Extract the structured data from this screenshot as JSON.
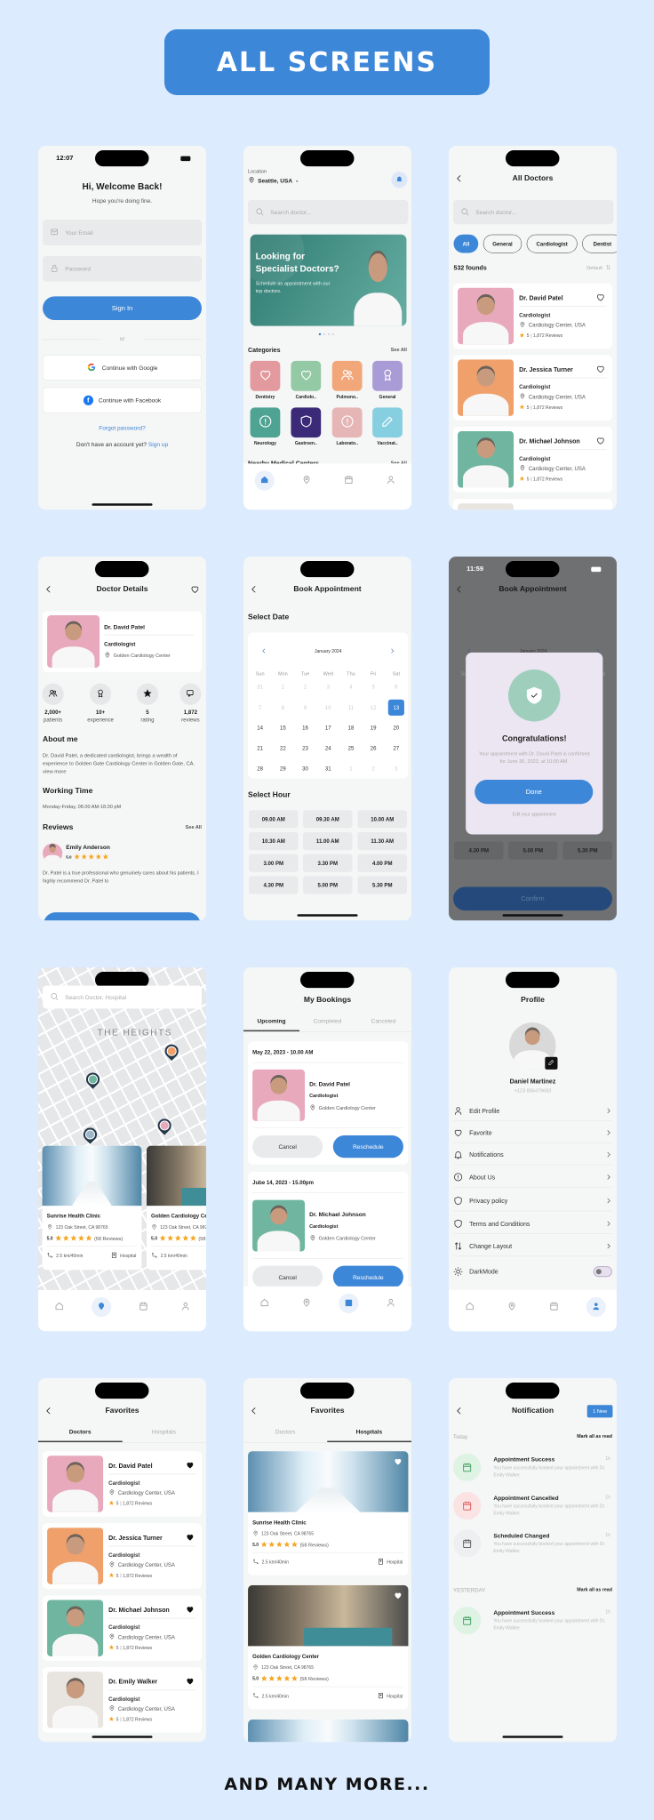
{
  "header": {
    "title": "ALL SCREENS"
  },
  "footer": {
    "text": "AND MANY MORE..."
  },
  "colors": {
    "primary": "#3d87d9",
    "background": "#dcebfd",
    "star": "#f5a623"
  },
  "login": {
    "time": "12:07",
    "title": "Hi, Welcome Back!",
    "subtitle": "Hope you're doing fine.",
    "email_placeholder": "Your Email",
    "password_placeholder": "Password",
    "sign_in": "Sign In",
    "or": "or",
    "google": "Continue with Google",
    "facebook": "Continue with Facebook",
    "forgot": "Forgot password?",
    "no_account": "Don't have an account yet?",
    "sign_up": "Sign up"
  },
  "home": {
    "location_label": "Location",
    "location": "Seattle, USA",
    "search_placeholder": "Search doctor...",
    "banner_title_1": "Looking for",
    "banner_title_2": "Specialist Doctors?",
    "banner_text": "Schedule an appointment with our top doctors.",
    "banner_page": 1,
    "banner_pages": 4,
    "categories_title": "Categories",
    "see_all": "See All",
    "categories": [
      {
        "label": "Dentistry",
        "color": "#e39a9e",
        "icon": "tooth-icon"
      },
      {
        "label": "Cardiolo..",
        "color": "#93c9a4",
        "icon": "heart-pulse-icon"
      },
      {
        "label": "Pulmono..",
        "color": "#f2a77a",
        "icon": "lungs-icon"
      },
      {
        "label": "General",
        "color": "#a99bd6",
        "icon": "stethoscope-icon"
      },
      {
        "label": "Neurology",
        "color": "#4ea393",
        "icon": "brain-icon"
      },
      {
        "label": "Gastroen..",
        "color": "#3b2a78",
        "icon": "stomach-icon"
      },
      {
        "label": "Laborato..",
        "color": "#e6b5b5",
        "icon": "flask-icon"
      },
      {
        "label": "Vaccinat..",
        "color": "#86cfe0",
        "icon": "syringe-icon"
      }
    ],
    "nearby_title": "Nearby Medical Centers",
    "nearby_see_all": "See All"
  },
  "all_doctors": {
    "title": "All Doctors",
    "search_placeholder": "Search doctor...",
    "chips": [
      "All",
      "General",
      "Cardiologist",
      "Dentist"
    ],
    "active_chip": "All",
    "found": "532 founds",
    "sort": "Default"
  },
  "doctors": [
    {
      "name": "Dr. David Patel",
      "specialty": "Cardiologist",
      "location": "Cardiology Center, USA",
      "rating": "5",
      "reviews": "1,872 Reviews",
      "photo_bg": "#e8a9bd"
    },
    {
      "name": "Dr. Jessica Turner",
      "specialty": "Cardiologist",
      "location": "Cardiology Center, USA",
      "rating": "5",
      "reviews": "1,872 Reviews",
      "photo_bg": "#f0a06a"
    },
    {
      "name": "Dr. Michael Johnson",
      "specialty": "Cardiologist",
      "location": "Cardiology Center, USA",
      "rating": "5",
      "reviews": "1,872 Reviews",
      "photo_bg": "#6fb5a0"
    },
    {
      "name": "Dr. Emily Walker",
      "specialty": "Cardiologist",
      "location": "Cardiology Center, USA",
      "rating": "5",
      "reviews": "1,872 Reviews",
      "photo_bg": "#e8e4df"
    }
  ],
  "doctor_details": {
    "title": "Doctor Details",
    "name": "Dr. David Patel",
    "specialty": "Cardiologist",
    "location": "Golden Cardiology Center",
    "stats": [
      {
        "value": "2,000+",
        "label": "patients",
        "icon": "users-icon"
      },
      {
        "value": "10+",
        "label": "experience",
        "icon": "award-icon"
      },
      {
        "value": "5",
        "label": "rating",
        "icon": "star-icon"
      },
      {
        "value": "1,872",
        "label": "reviews",
        "icon": "chat-icon"
      }
    ],
    "about_title": "About me",
    "about_text": "Dr. David Patel, a dedicated cardiologist, brings a wealth of experience to Golden Gate Cardiology Center in Golden Gate, CA.",
    "view_more": "view more",
    "working_title": "Working Time",
    "working_text": "Monday-Friday, 08.00 AM-18.00 pM",
    "reviews_title": "Reviews",
    "see_all": "See All",
    "review": {
      "name": "Emily Anderson",
      "rating": "5.0",
      "stars": 5,
      "text": "Dr. Patel is a true professional who genuinely cares about his patients. I highly recommend Dr. Patel to"
    }
  },
  "book": {
    "title": "Book Appointment",
    "select_date": "Select Date",
    "month": "January 2024",
    "weekdays": [
      "Sun",
      "Mon",
      "Tue",
      "Wed",
      "Thu",
      "Fri",
      "Sat"
    ],
    "days": [
      {
        "day": "31",
        "state": "other"
      },
      {
        "day": "1",
        "state": "past"
      },
      {
        "day": "2",
        "state": "past"
      },
      {
        "day": "3",
        "state": "past"
      },
      {
        "day": "4",
        "state": "past"
      },
      {
        "day": "5",
        "state": "past"
      },
      {
        "day": "6",
        "state": "past"
      },
      {
        "day": "7",
        "state": "past"
      },
      {
        "day": "8",
        "state": "past"
      },
      {
        "day": "9",
        "state": "past"
      },
      {
        "day": "10",
        "state": "past"
      },
      {
        "day": "11",
        "state": "past"
      },
      {
        "day": "12",
        "state": "past"
      },
      {
        "day": "13",
        "state": "selected"
      },
      {
        "day": "14",
        "state": "normal"
      },
      {
        "day": "15",
        "state": "normal"
      },
      {
        "day": "16",
        "state": "normal"
      },
      {
        "day": "17",
        "state": "normal"
      },
      {
        "day": "18",
        "state": "normal"
      },
      {
        "day": "19",
        "state": "normal"
      },
      {
        "day": "20",
        "state": "normal"
      },
      {
        "day": "21",
        "state": "normal"
      },
      {
        "day": "22",
        "state": "normal"
      },
      {
        "day": "23",
        "state": "normal"
      },
      {
        "day": "24",
        "state": "normal"
      },
      {
        "day": "25",
        "state": "normal"
      },
      {
        "day": "26",
        "state": "normal"
      },
      {
        "day": "27",
        "state": "normal"
      },
      {
        "day": "28",
        "state": "normal"
      },
      {
        "day": "29",
        "state": "normal"
      },
      {
        "day": "30",
        "state": "normal"
      },
      {
        "day": "31",
        "state": "normal"
      },
      {
        "day": "1",
        "state": "other"
      },
      {
        "day": "2",
        "state": "other"
      },
      {
        "day": "3",
        "state": "other"
      }
    ],
    "select_hour": "Select Hour",
    "hours": [
      "09.00 AM",
      "09.30 AM",
      "10.00 AM",
      "10.30 AM",
      "11.00 AM",
      "11.30 AM",
      "3.00 PM",
      "3.30 PM",
      "4.00 PM",
      "4.30 PM",
      "5.00 PM",
      "5.30 PM"
    ]
  },
  "success_modal": {
    "time": "11:59",
    "title": "Congratulations!",
    "text": "Your appointment with Dr. David Patel is confirmed for June 30, 2023, at 10:00 AM.",
    "done": "Done",
    "edit": "Edit your appointment",
    "confirm": "Confirm"
  },
  "map": {
    "search_placeholder": "Search Doctor, Hospital",
    "area": "THE HEIGHTS"
  },
  "hospitals": [
    {
      "name": "Sunrise Health Clinic",
      "address": "123 Oak Street, CA 98765",
      "rating": "5.0",
      "reviews": "(58 Reviews)",
      "distance": "2.5 km/40min",
      "type": "Hospital"
    },
    {
      "name": "Golden Cardiology Center",
      "address": "123 Oak Street, CA 98765",
      "rating": "5.0",
      "reviews": "(58 Reviews)",
      "distance": "2.5 km/40min",
      "type": "Hospital"
    }
  ],
  "bookings": {
    "title": "My Bookings",
    "tabs": [
      "Upcoming",
      "Completed",
      "Canceled"
    ],
    "active_tab": "Upcoming",
    "items": [
      {
        "date": "May 22, 2023 - 10.00 AM",
        "doctor": "Dr. David Patel",
        "specialty": "Cardiologist",
        "location": "Golden Cardiology Center",
        "photo_bg": "#e8a9bd"
      },
      {
        "date": "Jube 14, 2023 - 15.00pm",
        "doctor": "Dr. Michael Johnson",
        "specialty": "Cardiologist",
        "location": "Golden Cardiology Center",
        "photo_bg": "#6fb5a0"
      }
    ],
    "cancel": "Cancel",
    "reschedule": "Reschedule"
  },
  "profile": {
    "title": "Profile",
    "name": "Daniel Martinez",
    "phone": "+123 856479683",
    "menu": [
      {
        "label": "Edit Profile",
        "icon": "user-edit-icon"
      },
      {
        "label": "Favorite",
        "icon": "heart-icon"
      },
      {
        "label": "Notifications",
        "icon": "bell-icon"
      },
      {
        "label": "About Us",
        "icon": "info-icon"
      },
      {
        "label": "Privacy policy",
        "icon": "shield-check-icon"
      },
      {
        "label": "Terms and Conditions",
        "icon": "shield-icon"
      },
      {
        "label": "Change Layout",
        "icon": "sort-icon"
      }
    ],
    "dark_mode": "DarkMode",
    "dark_mode_on": false
  },
  "favorites": {
    "title": "Favorites",
    "tabs": [
      "Doctors",
      "Hospitals"
    ]
  },
  "notifications": {
    "title": "Notification",
    "badge": "1 New",
    "today": "Today",
    "yesterday": "YESTERDAY",
    "mark_all": "Mark all as read",
    "today_items": [
      {
        "title": "Appointment Success",
        "time": "1h",
        "text": "You have successfully booked your appointment with Dr. Emily Walker.",
        "bg": "#dff3e4",
        "fg": "#3b9a5b"
      },
      {
        "title": "Appointment Cancelled",
        "time": "1h",
        "text": "You have successfully booked your appointment with Dr. Emily Walker.",
        "bg": "#fbe3e3",
        "fg": "#d9534f"
      },
      {
        "title": "Scheduled Changed",
        "time": "1h",
        "text": "You have successfully booked your appointment with Dr. Emily Walker.",
        "bg": "#eeeff1",
        "fg": "#555555"
      }
    ],
    "yesterday_items": [
      {
        "title": "Appointment Success",
        "time": "1h",
        "text": "You have successfully booked your appointment with Dr. Emily Walker.",
        "bg": "#dff3e4",
        "fg": "#3b9a5b"
      }
    ]
  },
  "nav": [
    "home-icon",
    "map-pin-icon",
    "calendar-icon",
    "user-icon"
  ]
}
